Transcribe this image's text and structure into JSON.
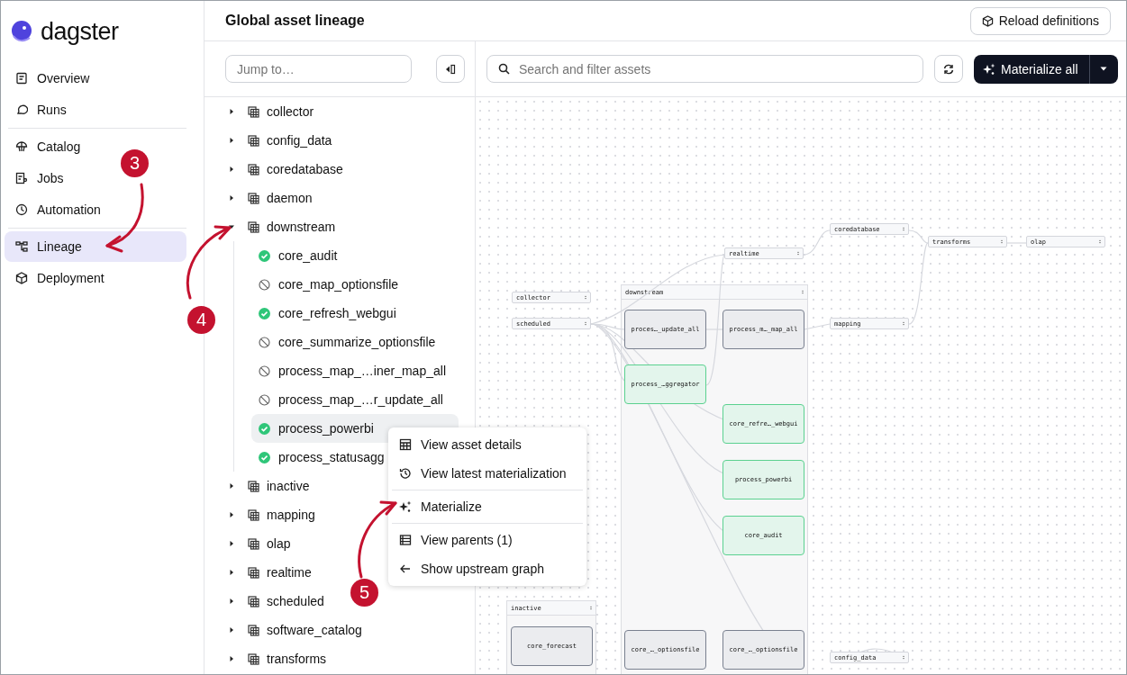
{
  "logo": {
    "text": "dagster"
  },
  "nav_groups": [
    [
      {
        "label": "Overview",
        "selected": false
      },
      {
        "label": "Runs",
        "selected": false
      }
    ],
    [
      {
        "label": "Catalog",
        "selected": false
      },
      {
        "label": "Jobs",
        "selected": false
      },
      {
        "label": "Automation",
        "selected": false
      }
    ],
    [
      {
        "label": "Lineage",
        "selected": true
      },
      {
        "label": "Deployment",
        "selected": false
      }
    ]
  ],
  "header": {
    "title": "Global asset lineage",
    "reload_button": "Reload definitions"
  },
  "tree_panel": {
    "jump_placeholder": "Jump to…",
    "items": [
      {
        "label": "collector",
        "expanded": false
      },
      {
        "label": "config_data",
        "expanded": false
      },
      {
        "label": "coredatabase",
        "expanded": false
      },
      {
        "label": "daemon",
        "expanded": false
      },
      {
        "label": "downstream",
        "expanded": true,
        "children": [
          {
            "label": "core_audit",
            "materialized": true,
            "selected": false
          },
          {
            "label": "core_map_optionsfile",
            "materialized": false,
            "selected": false
          },
          {
            "label": "core_refresh_webgui",
            "materialized": true,
            "selected": false
          },
          {
            "label": "core_summarize_optionsfile",
            "materialized": false,
            "selected": false
          },
          {
            "label": "process_map_…iner_map_all",
            "materialized": false,
            "selected": false
          },
          {
            "label": "process_map_…r_update_all",
            "materialized": false,
            "selected": false
          },
          {
            "label": "process_powerbi",
            "materialized": true,
            "selected": true
          },
          {
            "label": "process_statusagg",
            "materialized": true,
            "selected": false
          }
        ]
      },
      {
        "label": "inactive",
        "expanded": false
      },
      {
        "label": "mapping",
        "expanded": false
      },
      {
        "label": "olap",
        "expanded": false
      },
      {
        "label": "realtime",
        "expanded": false
      },
      {
        "label": "scheduled",
        "expanded": false
      },
      {
        "label": "software_catalog",
        "expanded": false
      },
      {
        "label": "transforms",
        "expanded": false
      }
    ]
  },
  "graph_toolbar": {
    "search_placeholder": "Search and filter assets",
    "materialize_button": "Materialize all"
  },
  "graph": {
    "group_nodes": [
      "collector",
      "scheduled",
      "realtime",
      "coredatabase",
      "transforms",
      "olap",
      "mapping",
      "config_data"
    ],
    "frames": [
      {
        "name": "downstream",
        "assets": [
          {
            "label": "proces…_update_all",
            "materialized": false
          },
          {
            "label": "process_m…_map_all",
            "materialized": false
          },
          {
            "label": "process_…ggregator",
            "materialized": true
          },
          {
            "label": "core_refre…_webgui",
            "materialized": true
          },
          {
            "label": "process_powerbi",
            "materialized": true
          },
          {
            "label": "core_audit",
            "materialized": true
          },
          {
            "label": "core_…_optionsfile",
            "materialized": false
          },
          {
            "label": "core_…_optionsfile",
            "materialized": false
          }
        ]
      },
      {
        "name": "inactive",
        "assets": [
          {
            "label": "core_forecast",
            "materialized": false
          }
        ]
      }
    ]
  },
  "context_menu": [
    [
      "View asset details",
      "View latest materialization"
    ],
    [
      "Materialize"
    ],
    [
      "View parents (1)",
      "Show upstream graph"
    ]
  ],
  "annotations": [
    "3",
    "4",
    "5"
  ]
}
